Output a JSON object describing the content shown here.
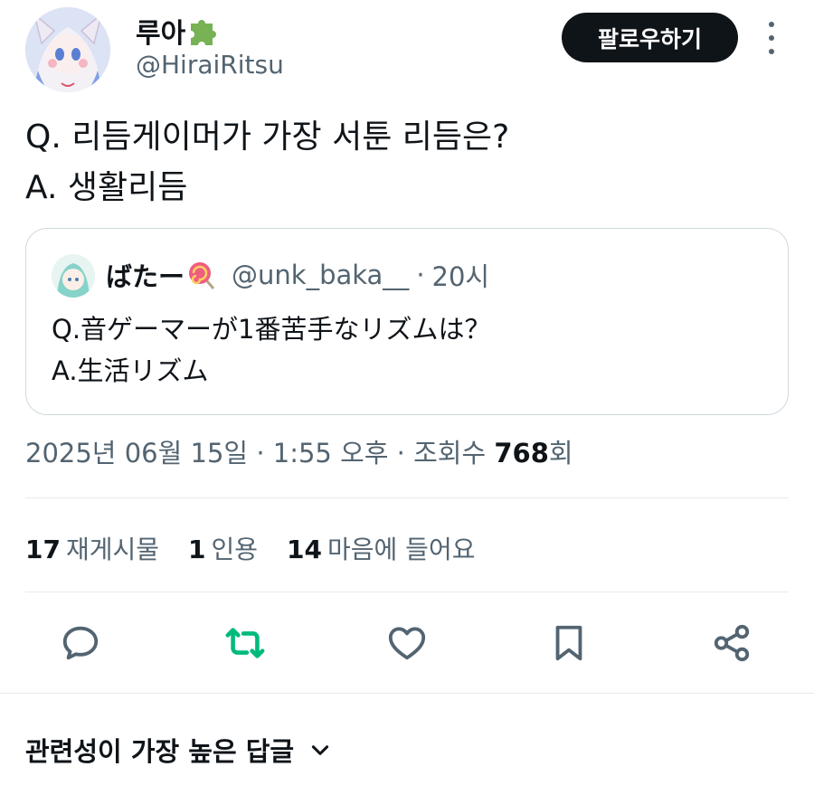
{
  "author": {
    "name": "루아",
    "handle": "@HiraiRitsu",
    "avatar_icon": "anime-avatar-icon",
    "badge_icon": "puzzle-piece-emoji"
  },
  "header": {
    "follow_label": "팔로우하기",
    "more_icon": "vertical-ellipsis-icon"
  },
  "tweet": {
    "lines": [
      "Q. 리듬게이머가 가장 서툰 리듬은?",
      "A. 생활리듬"
    ]
  },
  "quote": {
    "name": "ばたー",
    "emoji": "lollipop-emoji",
    "handle": "@unk_baka__",
    "separator": "·",
    "time": "20시",
    "lines": [
      "Q.音ゲーマーが1番苦手なリズムは？",
      "A.生活リズム"
    ]
  },
  "meta": {
    "date": "2025년 06월 15일",
    "sep1": "·",
    "time": "1:55 오후",
    "sep2": "·",
    "views_label": "조회수",
    "views_count": "768",
    "views_unit": "회"
  },
  "stats": [
    {
      "count": "17",
      "label": "재게시물"
    },
    {
      "count": "1",
      "label": "인용"
    },
    {
      "count": "14",
      "label": "마음에 들어요"
    }
  ],
  "actions": [
    {
      "icon": "reply-icon",
      "color": "#536471"
    },
    {
      "icon": "repost-icon",
      "color": "#00ba7c"
    },
    {
      "icon": "like-icon",
      "color": "#536471"
    },
    {
      "icon": "bookmark-icon",
      "color": "#536471"
    },
    {
      "icon": "share-icon",
      "color": "#536471"
    }
  ],
  "replies": {
    "sort_label": "관련성이 가장 높은 답글",
    "chevron_icon": "chevron-down-icon"
  },
  "colors": {
    "text": "#0f1419",
    "secondary": "#536471",
    "border": "#cfd9de",
    "repost": "#00ba7c"
  }
}
